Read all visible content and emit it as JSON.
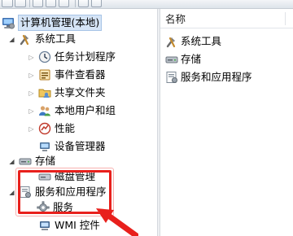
{
  "tree": {
    "root": {
      "label": "计算机管理(本地)",
      "icon": "computer-management-icon"
    },
    "system_tools": {
      "label": "系统工具",
      "icon": "tools-icon",
      "children": [
        {
          "label": "任务计划程序",
          "icon": "task-scheduler-icon"
        },
        {
          "label": "事件查看器",
          "icon": "event-viewer-icon"
        },
        {
          "label": "共享文件夹",
          "icon": "shared-folders-icon"
        },
        {
          "label": "本地用户和组",
          "icon": "users-groups-icon"
        },
        {
          "label": "性能",
          "icon": "performance-icon"
        },
        {
          "label": "设备管理器",
          "icon": "device-manager-icon"
        }
      ]
    },
    "storage": {
      "label": "存储",
      "icon": "storage-icon",
      "children": [
        {
          "label": "磁盘管理",
          "icon": "disk-management-icon"
        }
      ]
    },
    "services_apps": {
      "label": "服务和应用程序",
      "icon": "services-apps-icon",
      "children": [
        {
          "label": "服务",
          "icon": "services-gear-icon"
        },
        {
          "label": "WMI 控件",
          "icon": "wmi-control-icon"
        }
      ]
    }
  },
  "details": {
    "column_header": "名称",
    "items": [
      {
        "label": "系统工具",
        "icon": "tools-icon"
      },
      {
        "label": "存储",
        "icon": "storage-icon"
      },
      {
        "label": "服务和应用程序",
        "icon": "services-apps-icon"
      }
    ]
  },
  "annotation": {
    "highlight_color": "#e8201c"
  }
}
